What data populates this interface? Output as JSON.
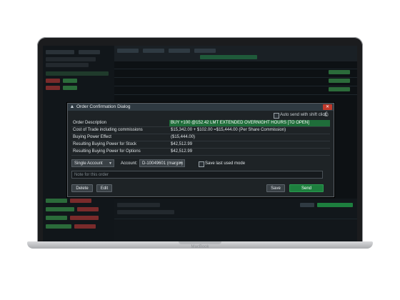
{
  "device": {
    "brand_label": "MacBook"
  },
  "dialog": {
    "title": "Order Confirmation Dialog",
    "close_label": "✕",
    "auto_send_label": "Auto send with shift click",
    "rows": [
      {
        "label": "Order Description",
        "value": "BUY +100 @152.42 LMT EXTENDED OVERNIGHT HOURS [TO OPEN]"
      },
      {
        "label": "Cost of Trade including commissions",
        "value": "$15,342.00 + $102.00 =$15,444.00 (Per Share Commission)"
      },
      {
        "label": "Buying Power Effect",
        "value": "($15,444.00)"
      },
      {
        "label": "Resulting Buying Power for Stock",
        "value": "$42,512.99"
      },
      {
        "label": "Resulting Buying Power for Options",
        "value": "$42,512.99"
      }
    ],
    "account_type": "Single Account",
    "account_label": "Account:",
    "account_value": "D-10049601 (margin)",
    "save_last_label": "Save last used mode",
    "note_placeholder": "Note for this order",
    "buttons": {
      "delete": "Delete",
      "edit": "Edit",
      "save": "Save",
      "send": "Send"
    }
  },
  "colors": {
    "highlight": "#1f6e3a",
    "send": "#1d7f3e",
    "close": "#c0392b"
  }
}
